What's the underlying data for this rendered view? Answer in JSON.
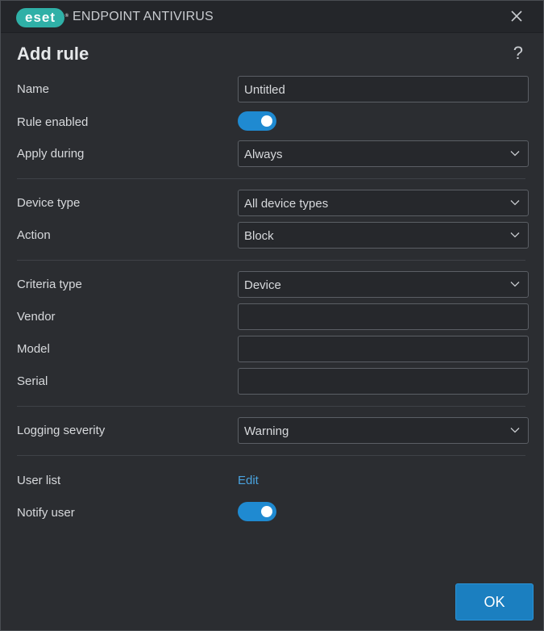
{
  "titlebar": {
    "logo_text": "eset",
    "logo_mark": "®",
    "app_title": "ENDPOINT ANTIVIRUS"
  },
  "dialog": {
    "title": "Add rule",
    "help_label": "?"
  },
  "fields": {
    "name": {
      "label": "Name",
      "value": "Untitled"
    },
    "rule_enabled": {
      "label": "Rule enabled",
      "on": true
    },
    "apply_during": {
      "label": "Apply during",
      "value": "Always"
    },
    "device_type": {
      "label": "Device type",
      "value": "All device types"
    },
    "action": {
      "label": "Action",
      "value": "Block"
    },
    "criteria_type": {
      "label": "Criteria type",
      "value": "Device"
    },
    "vendor": {
      "label": "Vendor",
      "value": ""
    },
    "model": {
      "label": "Model",
      "value": ""
    },
    "serial": {
      "label": "Serial",
      "value": ""
    },
    "logging_severity": {
      "label": "Logging severity",
      "value": "Warning"
    },
    "user_list": {
      "label": "User list",
      "link": "Edit"
    },
    "notify_user": {
      "label": "Notify user",
      "on": true
    }
  },
  "footer": {
    "ok_label": "OK"
  },
  "colors": {
    "accent": "#1f8ad1",
    "logo": "#2fb0a7",
    "link": "#4aa3df",
    "background": "#2b2d31"
  },
  "icons": {
    "close": "close-icon",
    "dropdown": "chevron-down-icon"
  }
}
